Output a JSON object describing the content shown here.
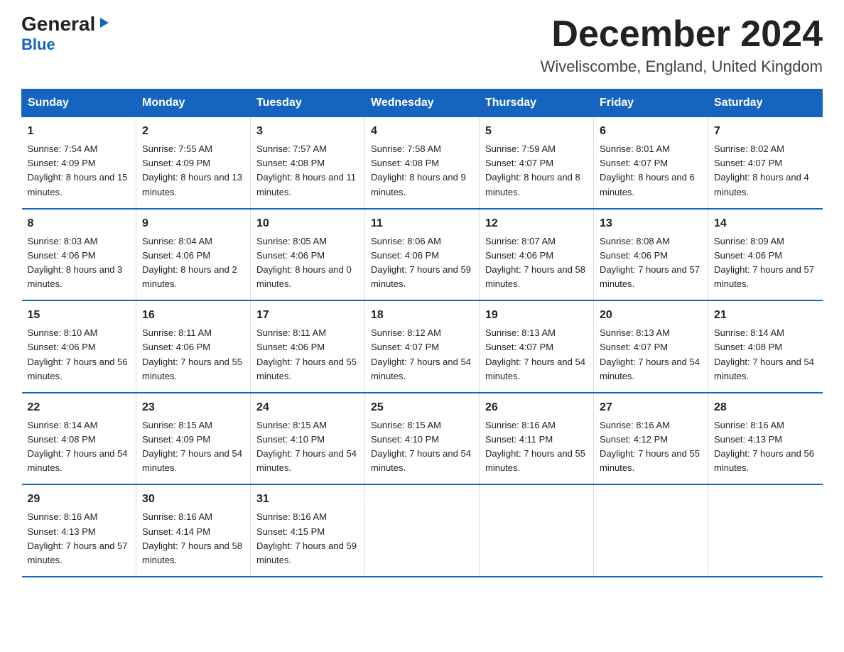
{
  "logo": {
    "general": "General",
    "arrow_char": "▶",
    "blue": "Blue"
  },
  "header": {
    "month_year": "December 2024",
    "location": "Wiveliscombe, England, United Kingdom"
  },
  "days_of_week": [
    "Sunday",
    "Monday",
    "Tuesday",
    "Wednesday",
    "Thursday",
    "Friday",
    "Saturday"
  ],
  "weeks": [
    [
      {
        "day": "1",
        "sunrise": "Sunrise: 7:54 AM",
        "sunset": "Sunset: 4:09 PM",
        "daylight": "Daylight: 8 hours and 15 minutes."
      },
      {
        "day": "2",
        "sunrise": "Sunrise: 7:55 AM",
        "sunset": "Sunset: 4:09 PM",
        "daylight": "Daylight: 8 hours and 13 minutes."
      },
      {
        "day": "3",
        "sunrise": "Sunrise: 7:57 AM",
        "sunset": "Sunset: 4:08 PM",
        "daylight": "Daylight: 8 hours and 11 minutes."
      },
      {
        "day": "4",
        "sunrise": "Sunrise: 7:58 AM",
        "sunset": "Sunset: 4:08 PM",
        "daylight": "Daylight: 8 hours and 9 minutes."
      },
      {
        "day": "5",
        "sunrise": "Sunrise: 7:59 AM",
        "sunset": "Sunset: 4:07 PM",
        "daylight": "Daylight: 8 hours and 8 minutes."
      },
      {
        "day": "6",
        "sunrise": "Sunrise: 8:01 AM",
        "sunset": "Sunset: 4:07 PM",
        "daylight": "Daylight: 8 hours and 6 minutes."
      },
      {
        "day": "7",
        "sunrise": "Sunrise: 8:02 AM",
        "sunset": "Sunset: 4:07 PM",
        "daylight": "Daylight: 8 hours and 4 minutes."
      }
    ],
    [
      {
        "day": "8",
        "sunrise": "Sunrise: 8:03 AM",
        "sunset": "Sunset: 4:06 PM",
        "daylight": "Daylight: 8 hours and 3 minutes."
      },
      {
        "day": "9",
        "sunrise": "Sunrise: 8:04 AM",
        "sunset": "Sunset: 4:06 PM",
        "daylight": "Daylight: 8 hours and 2 minutes."
      },
      {
        "day": "10",
        "sunrise": "Sunrise: 8:05 AM",
        "sunset": "Sunset: 4:06 PM",
        "daylight": "Daylight: 8 hours and 0 minutes."
      },
      {
        "day": "11",
        "sunrise": "Sunrise: 8:06 AM",
        "sunset": "Sunset: 4:06 PM",
        "daylight": "Daylight: 7 hours and 59 minutes."
      },
      {
        "day": "12",
        "sunrise": "Sunrise: 8:07 AM",
        "sunset": "Sunset: 4:06 PM",
        "daylight": "Daylight: 7 hours and 58 minutes."
      },
      {
        "day": "13",
        "sunrise": "Sunrise: 8:08 AM",
        "sunset": "Sunset: 4:06 PM",
        "daylight": "Daylight: 7 hours and 57 minutes."
      },
      {
        "day": "14",
        "sunrise": "Sunrise: 8:09 AM",
        "sunset": "Sunset: 4:06 PM",
        "daylight": "Daylight: 7 hours and 57 minutes."
      }
    ],
    [
      {
        "day": "15",
        "sunrise": "Sunrise: 8:10 AM",
        "sunset": "Sunset: 4:06 PM",
        "daylight": "Daylight: 7 hours and 56 minutes."
      },
      {
        "day": "16",
        "sunrise": "Sunrise: 8:11 AM",
        "sunset": "Sunset: 4:06 PM",
        "daylight": "Daylight: 7 hours and 55 minutes."
      },
      {
        "day": "17",
        "sunrise": "Sunrise: 8:11 AM",
        "sunset": "Sunset: 4:06 PM",
        "daylight": "Daylight: 7 hours and 55 minutes."
      },
      {
        "day": "18",
        "sunrise": "Sunrise: 8:12 AM",
        "sunset": "Sunset: 4:07 PM",
        "daylight": "Daylight: 7 hours and 54 minutes."
      },
      {
        "day": "19",
        "sunrise": "Sunrise: 8:13 AM",
        "sunset": "Sunset: 4:07 PM",
        "daylight": "Daylight: 7 hours and 54 minutes."
      },
      {
        "day": "20",
        "sunrise": "Sunrise: 8:13 AM",
        "sunset": "Sunset: 4:07 PM",
        "daylight": "Daylight: 7 hours and 54 minutes."
      },
      {
        "day": "21",
        "sunrise": "Sunrise: 8:14 AM",
        "sunset": "Sunset: 4:08 PM",
        "daylight": "Daylight: 7 hours and 54 minutes."
      }
    ],
    [
      {
        "day": "22",
        "sunrise": "Sunrise: 8:14 AM",
        "sunset": "Sunset: 4:08 PM",
        "daylight": "Daylight: 7 hours and 54 minutes."
      },
      {
        "day": "23",
        "sunrise": "Sunrise: 8:15 AM",
        "sunset": "Sunset: 4:09 PM",
        "daylight": "Daylight: 7 hours and 54 minutes."
      },
      {
        "day": "24",
        "sunrise": "Sunrise: 8:15 AM",
        "sunset": "Sunset: 4:10 PM",
        "daylight": "Daylight: 7 hours and 54 minutes."
      },
      {
        "day": "25",
        "sunrise": "Sunrise: 8:15 AM",
        "sunset": "Sunset: 4:10 PM",
        "daylight": "Daylight: 7 hours and 54 minutes."
      },
      {
        "day": "26",
        "sunrise": "Sunrise: 8:16 AM",
        "sunset": "Sunset: 4:11 PM",
        "daylight": "Daylight: 7 hours and 55 minutes."
      },
      {
        "day": "27",
        "sunrise": "Sunrise: 8:16 AM",
        "sunset": "Sunset: 4:12 PM",
        "daylight": "Daylight: 7 hours and 55 minutes."
      },
      {
        "day": "28",
        "sunrise": "Sunrise: 8:16 AM",
        "sunset": "Sunset: 4:13 PM",
        "daylight": "Daylight: 7 hours and 56 minutes."
      }
    ],
    [
      {
        "day": "29",
        "sunrise": "Sunrise: 8:16 AM",
        "sunset": "Sunset: 4:13 PM",
        "daylight": "Daylight: 7 hours and 57 minutes."
      },
      {
        "day": "30",
        "sunrise": "Sunrise: 8:16 AM",
        "sunset": "Sunset: 4:14 PM",
        "daylight": "Daylight: 7 hours and 58 minutes."
      },
      {
        "day": "31",
        "sunrise": "Sunrise: 8:16 AM",
        "sunset": "Sunset: 4:15 PM",
        "daylight": "Daylight: 7 hours and 59 minutes."
      },
      {
        "day": "",
        "sunrise": "",
        "sunset": "",
        "daylight": ""
      },
      {
        "day": "",
        "sunrise": "",
        "sunset": "",
        "daylight": ""
      },
      {
        "day": "",
        "sunrise": "",
        "sunset": "",
        "daylight": ""
      },
      {
        "day": "",
        "sunrise": "",
        "sunset": "",
        "daylight": ""
      }
    ]
  ]
}
